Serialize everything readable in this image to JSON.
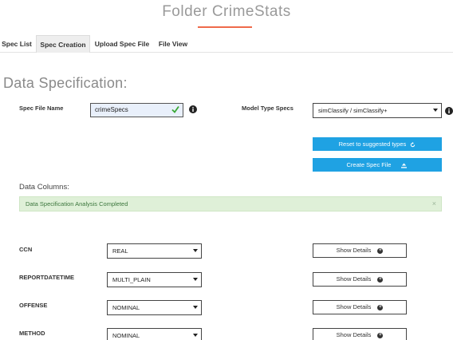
{
  "app": {
    "title": "Folder CrimeStats",
    "accent_color": "#ef6a4b"
  },
  "tabs": [
    {
      "label": "Spec List"
    },
    {
      "label": "Spec Creation",
      "active": true
    },
    {
      "label": "Upload Spec File"
    },
    {
      "label": "File View"
    }
  ],
  "section": {
    "title": "Data Specification:"
  },
  "form": {
    "spec_file_label": "Spec File Name",
    "spec_file_value": "crimeSpecs",
    "model_type_label": "Model Type Specs",
    "model_type_value": "simClassify / simClassify+"
  },
  "buttons": {
    "reset_label": "Reset to suggested types",
    "create_label": "Create Spec File",
    "color": "#1fa2e3"
  },
  "data_columns": {
    "heading": "Data Columns:",
    "alert_text": "Data Specification Analysis Completed",
    "alert_close": "×",
    "details_label": "Show Details",
    "rows": [
      {
        "name": "CCN",
        "type": "REAL"
      },
      {
        "name": "REPORTDATETIME",
        "type": "MULTI_PLAIN"
      },
      {
        "name": "OFFENSE",
        "type": "NOMINAL"
      },
      {
        "name": "METHOD",
        "type": "NOMINAL"
      }
    ]
  }
}
